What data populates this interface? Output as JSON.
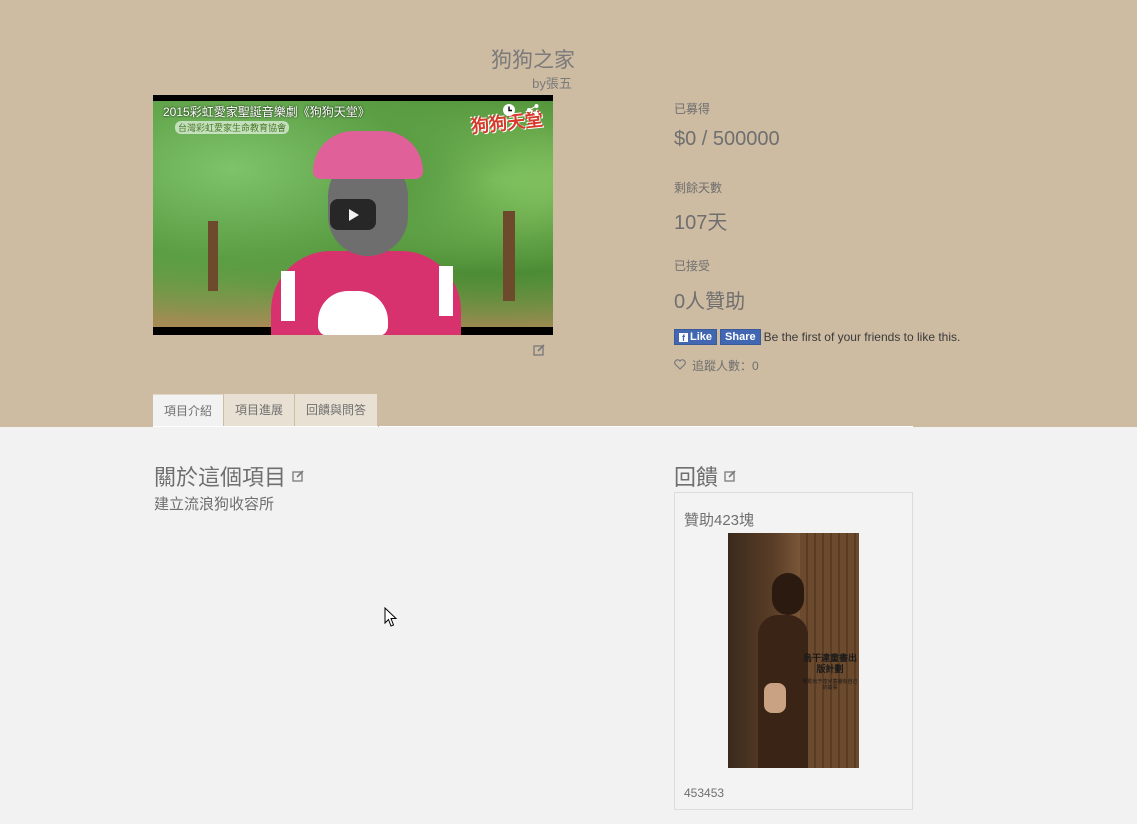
{
  "project": {
    "title": "狗狗之家",
    "author": "by張五"
  },
  "video": {
    "title": "2015彩虹愛家聖誕音樂劇《狗狗天堂》",
    "subtitle": "台灣彩虹愛家生命教育協會",
    "logo_text": "狗狗天堂",
    "icons": [
      "clock-icon",
      "share-icon",
      "play-icon"
    ]
  },
  "stats": {
    "raised_label": "已募得",
    "raised_value": "$0 / 500000",
    "days_label": "剩餘天數",
    "days_value": "107天",
    "backers_label": "已接受",
    "backers_value": "0人贊助"
  },
  "facebook": {
    "like_label": "Like",
    "share_label": "Share",
    "social_text": "Be the first of your friends to like this."
  },
  "follow": {
    "label": "追蹤人數：0"
  },
  "tabs": [
    {
      "label": "項目介紹",
      "active": true
    },
    {
      "label": "項目進展",
      "active": false
    },
    {
      "label": "回饋與問答",
      "active": false
    }
  ],
  "about": {
    "heading": "關於這個項目",
    "text": "建立流浪狗收容所"
  },
  "reward": {
    "heading": "回饋",
    "amount": "贊助423塊",
    "image_title": "烏干達童書出版計劃",
    "image_subtitle": "幫助烏干達兒童擁有自己的故事",
    "description": "453453"
  },
  "colors": {
    "hero_bg": "#cdbba2",
    "page_bg": "#f2f2f2",
    "facebook_blue": "#4267b2"
  }
}
